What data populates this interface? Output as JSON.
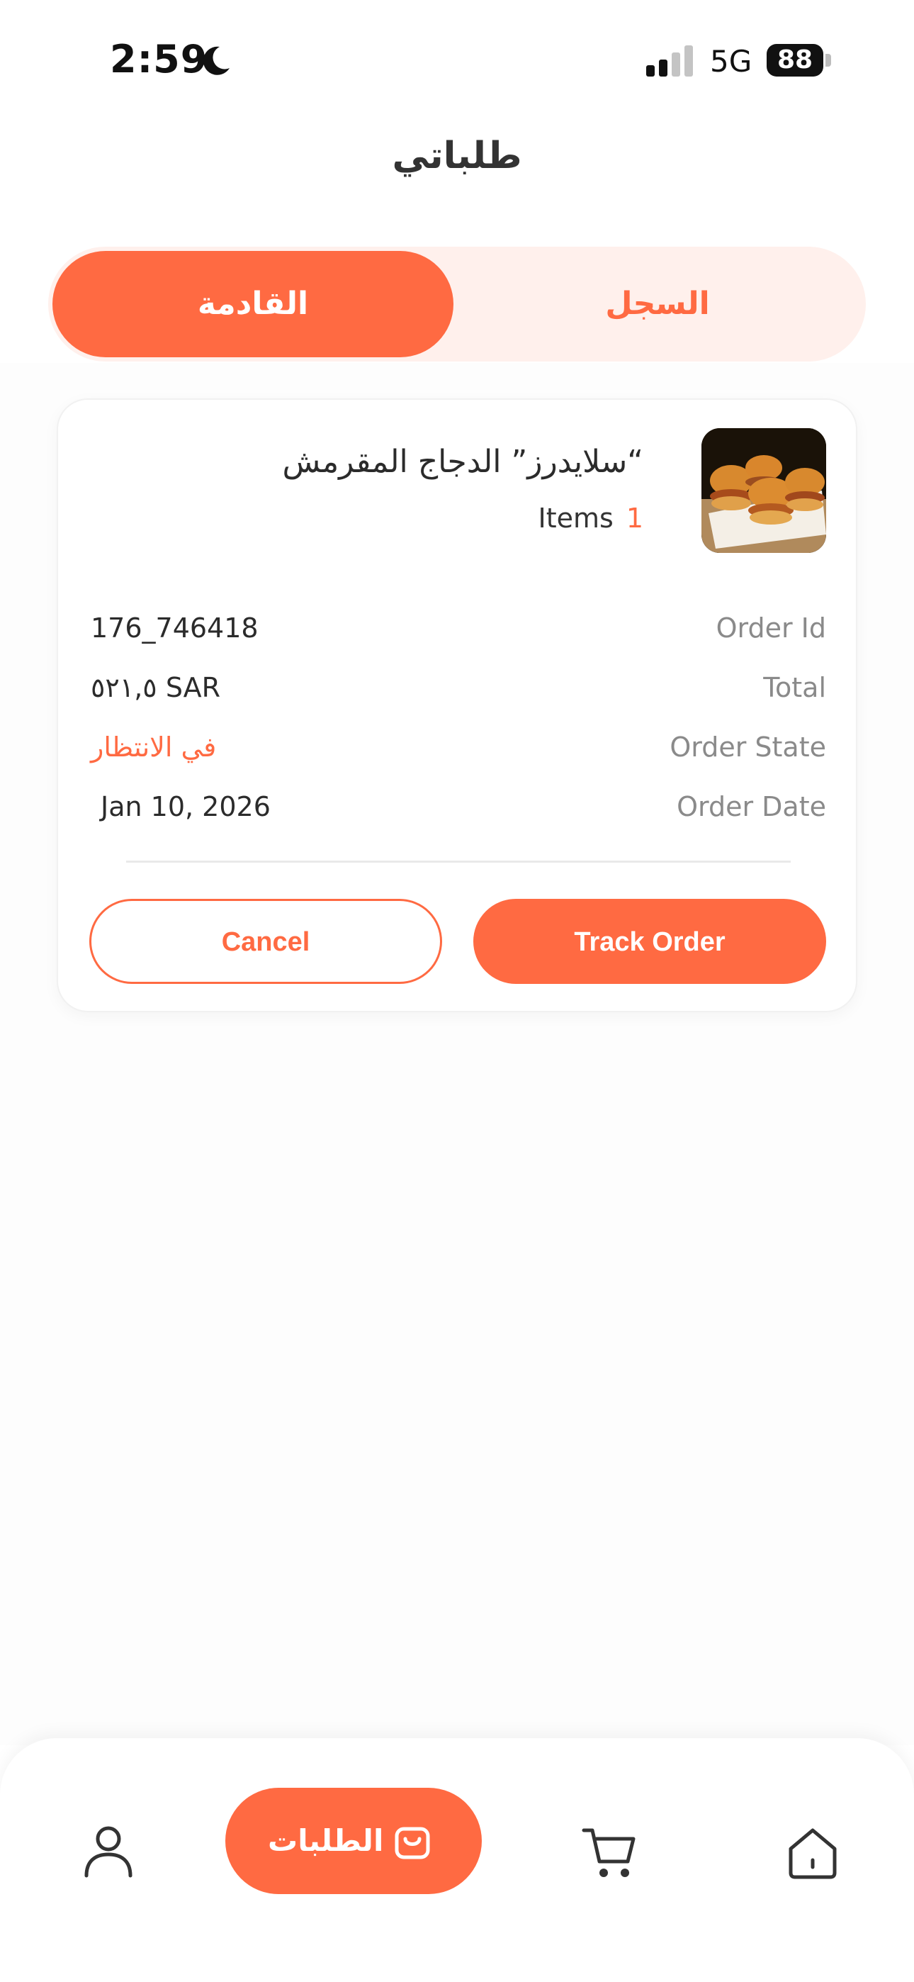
{
  "status_bar": {
    "time": "2:59",
    "network": "5G",
    "battery": "88"
  },
  "header": {
    "title": "طلباتي"
  },
  "tabs": {
    "upcoming": "القادمة",
    "history": "السجل"
  },
  "order": {
    "item_name": "“سلايدرز” الدجاج المقرمش",
    "items_count": "1",
    "items_label": "Items",
    "rows": [
      {
        "label": "Order Id",
        "value": "176_746418"
      },
      {
        "label": "Total",
        "value": "٥٢١,٥ SAR"
      },
      {
        "label": "Order State",
        "value": "في الانتظار"
      },
      {
        "label": "Order Date",
        "value": "Jan 10, 2026"
      }
    ],
    "cancel_label": "Cancel",
    "track_label": "Track Order"
  },
  "bottom_nav": {
    "orders_label": "الطلبات"
  },
  "colors": {
    "accent": "#ff6a42",
    "accent_light": "#fff0ec"
  }
}
